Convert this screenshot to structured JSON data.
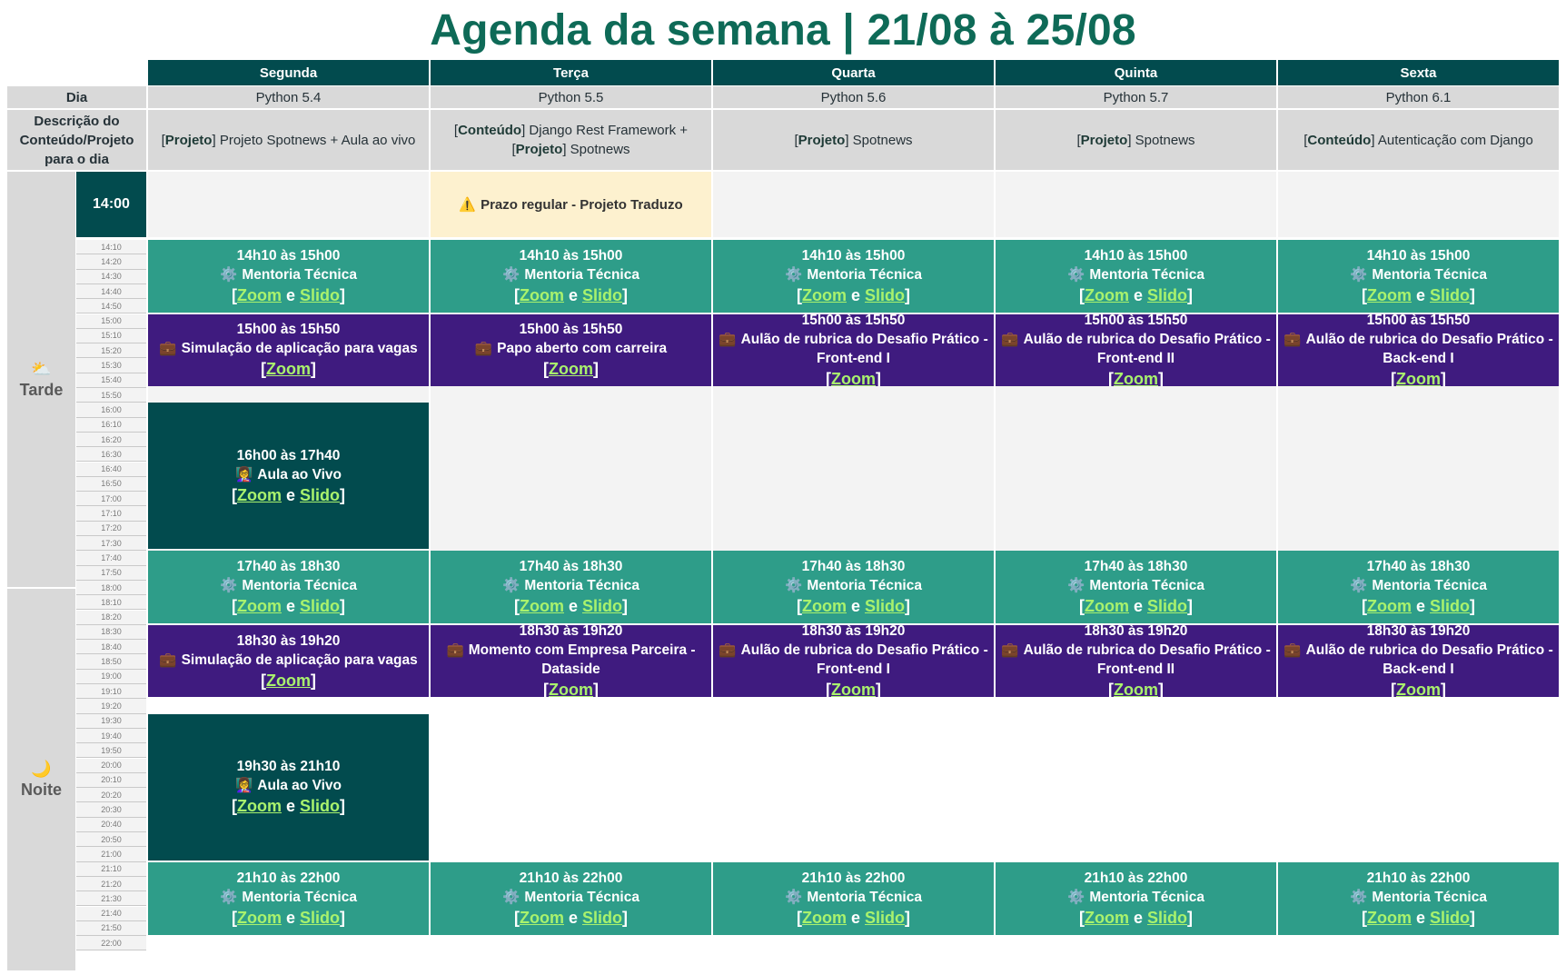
{
  "title": "Agenda da semana | 21/08 à 25/08",
  "days": [
    "Segunda",
    "Terça",
    "Quarta",
    "Quinta",
    "Sexta"
  ],
  "row_labels": {
    "dia": "Dia",
    "descricao": "Descrição do Conteúdo/Projeto para o dia"
  },
  "dia_values": [
    "Python 5.4",
    "Python 5.5",
    "Python 5.6",
    "Python 5.7",
    "Python 6.1"
  ],
  "descriptions": [
    [
      {
        "tag": "Projeto",
        "text": "Projeto Spotnews + Aula ao vivo"
      }
    ],
    [
      {
        "tag": "Conteúdo",
        "text": "Django Rest Framework +"
      },
      {
        "tag": "Projeto",
        "text": "Spotnews"
      }
    ],
    [
      {
        "tag": "Projeto",
        "text": "Spotnews"
      }
    ],
    [
      {
        "tag": "Projeto",
        "text": "Spotnews"
      }
    ],
    [
      {
        "tag": "Conteúdo",
        "text": "Autenticação com Django"
      }
    ]
  ],
  "periods": [
    {
      "label": "Tarde",
      "icon": "⛅"
    },
    {
      "label": "Noite",
      "icon": "🌙"
    }
  ],
  "start_time": "14:00",
  "ticks": [
    "14:10",
    "14:20",
    "14:30",
    "14:40",
    "14:50",
    "15:00",
    "15:10",
    "15:20",
    "15:30",
    "15:40",
    "15:50",
    "16:00",
    "16:10",
    "16:20",
    "16:30",
    "16:40",
    "16:50",
    "17:00",
    "17:10",
    "17:20",
    "17:30",
    "17:40",
    "17:50",
    "18:00",
    "18:10",
    "18:20",
    "18:30",
    "18:40",
    "18:50",
    "19:00",
    "19:10",
    "19:20",
    "19:30",
    "19:40",
    "19:50",
    "20:00",
    "20:10",
    "20:20",
    "20:30",
    "20:40",
    "20:50",
    "21:00",
    "21:10",
    "21:20",
    "21:30",
    "21:40",
    "21:50",
    "22:00"
  ],
  "deadline": {
    "icon": "⚠️",
    "text": "Prazo regular - Projeto Traduzo"
  },
  "links": {
    "zoom": "Zoom",
    "slido": "Slido",
    "and": "e"
  },
  "events": {
    "mentoria_1": {
      "time": "14h10 às 15h00",
      "icon": "⚙️",
      "title": "Mentoria Técnica"
    },
    "b1_seg": {
      "time": "15h00 às 15h50",
      "icon": "💼",
      "title": "Simulação de aplicação para vagas"
    },
    "b1_ter": {
      "time": "15h00 às 15h50",
      "icon": "💼",
      "title": "Papo aberto com carreira"
    },
    "b1_qua": {
      "time": "15h00 às 15h50",
      "icon": "💼",
      "title": "Aulão de rubrica do Desafio Prático - Front-end I"
    },
    "b1_qui": {
      "time": "15h00 às 15h50",
      "icon": "💼",
      "title": "Aulão de rubrica do Desafio Prático - Front-end II"
    },
    "b1_sex": {
      "time": "15h00 às 15h50",
      "icon": "💼",
      "title": "Aulão de rubrica do Desafio Prático - Back-end I"
    },
    "aula_1": {
      "time": "16h00 às 17h40",
      "icon": "👩‍🏫",
      "title": "Aula ao Vivo"
    },
    "mentoria_2": {
      "time": "17h40 às 18h30",
      "icon": "⚙️",
      "title": "Mentoria Técnica"
    },
    "b2_seg": {
      "time": "18h30 às 19h20",
      "icon": "💼",
      "title": "Simulação de aplicação para vagas"
    },
    "b2_ter": {
      "time": "18h30 às 19h20",
      "icon": "💼",
      "title": "Momento com Empresa Parceira - Dataside"
    },
    "b2_qua": {
      "time": "18h30 às 19h20",
      "icon": "💼",
      "title": "Aulão de rubrica do Desafio Prático - Front-end I"
    },
    "b2_qui": {
      "time": "18h30 às 19h20",
      "icon": "💼",
      "title": "Aulão de rubrica do Desafio Prático - Front-end II"
    },
    "b2_sex": {
      "time": "18h30 às 19h20",
      "icon": "💼",
      "title": "Aulão de rubrica do Desafio Prático - Back-end I"
    },
    "aula_2": {
      "time": "19h30 às 21h10",
      "icon": "👩‍🏫",
      "title": "Aula ao Vivo"
    },
    "mentoria_3": {
      "time": "21h10 às 22h00",
      "icon": "⚙️",
      "title": "Mentoria Técnica"
    }
  },
  "colors": {
    "header": "#024b4e",
    "teal": "#2e9d89",
    "purple": "#3f1b7f",
    "dark": "#024b4e",
    "title": "#0e6a57",
    "link": "#a9f26d",
    "deadline": "#fdf1cf"
  }
}
